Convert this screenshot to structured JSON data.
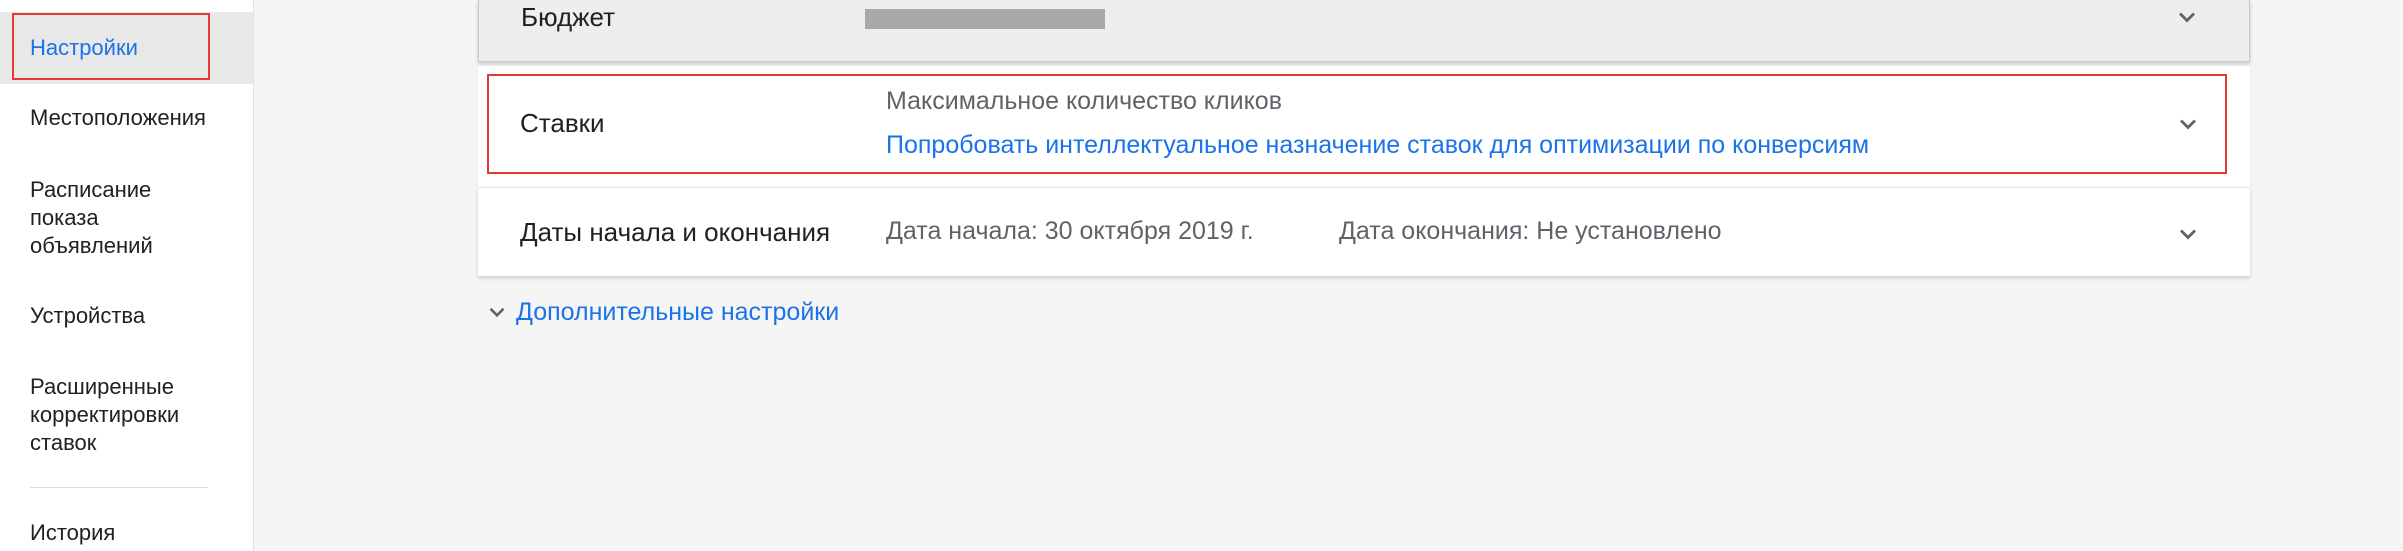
{
  "sidebar": {
    "items": [
      {
        "label": "Настройки"
      },
      {
        "label": "Местоположения"
      },
      {
        "label": "Расписание показа объявлений"
      },
      {
        "label": "Устройства"
      },
      {
        "label": "Расширенные корректировки ставок"
      },
      {
        "label": "История"
      }
    ]
  },
  "main": {
    "budget": {
      "title": "Бюджет"
    },
    "bids": {
      "title": "Ставки",
      "subtitle": "Максимальное количество кликов",
      "link": "Попробовать интеллектуальное назначение ставок для оптимизации по конверсиям"
    },
    "dates": {
      "title": "Даты начала и окончания",
      "start": "Дата начала: 30 октября 2019 г.",
      "end": "Дата окончания: Не установлено"
    },
    "more_settings": "Дополнительные настройки"
  },
  "colors": {
    "accent": "#1a73e8",
    "highlight": "#e53935",
    "text": "#202124",
    "secondary_text": "#5f6368"
  },
  "icons": {
    "expand": "chevron-down-icon"
  }
}
